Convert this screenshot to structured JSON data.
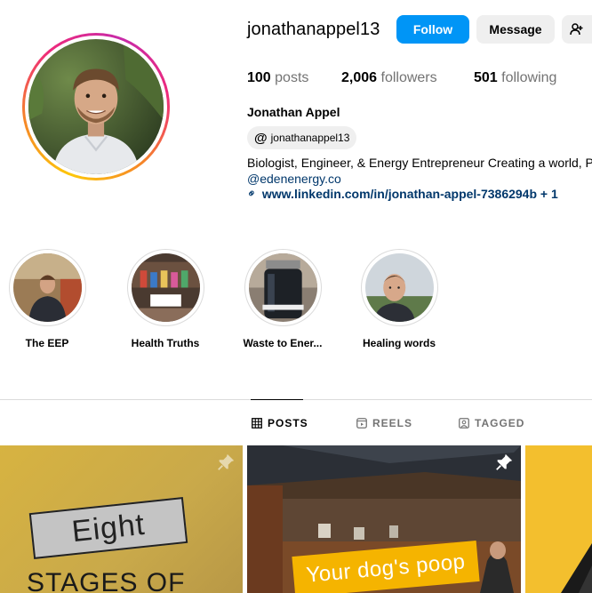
{
  "profile": {
    "username": "jonathanappel13",
    "follow_label": "Follow",
    "message_label": "Message",
    "posts_count": "100",
    "posts_label": "posts",
    "followers_count": "2,006",
    "followers_label": "followers",
    "following_count": "501",
    "following_label": "following",
    "full_name": "Jonathan Appel",
    "threads_handle": "jonathanappel13",
    "bio": "Biologist, Engineer, & Energy Entrepreneur Creating a world, Po",
    "bio_link": "@edenenergy.co",
    "external_link": "www.linkedin.com/in/jonathan-appel-7386294b + 1"
  },
  "highlights": [
    {
      "label": "The EEP"
    },
    {
      "label": "Health Truths"
    },
    {
      "label": "Waste to Ener..."
    },
    {
      "label": "Healing words"
    }
  ],
  "tabs": [
    {
      "label": "POSTS",
      "active": true
    },
    {
      "label": "REELS",
      "active": false
    },
    {
      "label": "TAGGED",
      "active": false
    }
  ],
  "posts": [
    {
      "line1": "Eight",
      "line2": "STAGES OF"
    },
    {
      "caption": "Your dog's poop"
    },
    {}
  ],
  "colors": {
    "follow_button": "#0095f6",
    "link": "#00376b",
    "secondary_text": "#737373"
  },
  "icons": {
    "add_user": "person-plus-icon",
    "threads": "threads-icon",
    "link": "link-icon",
    "posts_tab": "grid-icon",
    "reels_tab": "reels-icon",
    "tagged_tab": "tagged-icon",
    "pinned": "pin-icon"
  }
}
